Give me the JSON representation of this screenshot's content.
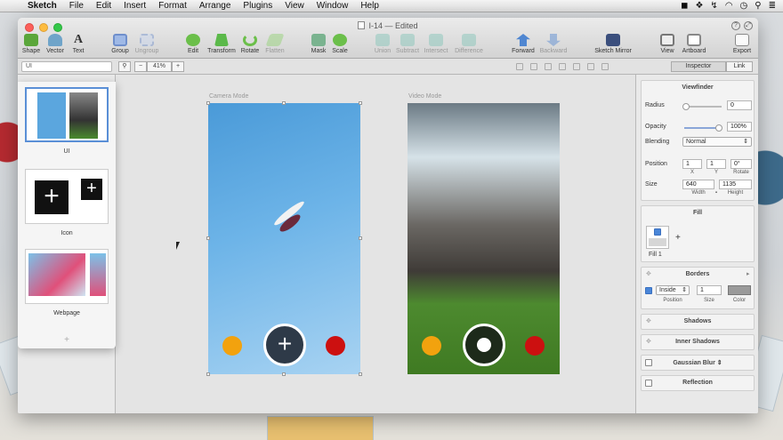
{
  "menubar": {
    "app": "Sketch",
    "items": [
      "File",
      "Edit",
      "Insert",
      "Format",
      "Arrange",
      "Plugins",
      "View",
      "Window",
      "Help"
    ]
  },
  "window": {
    "title": "I-14 — Edited"
  },
  "toolbar": {
    "left": [
      {
        "label": "Shape",
        "color": "#5aa63a"
      },
      {
        "label": "Vector",
        "color": "#6fa4c9"
      },
      {
        "label": "Text",
        "color": "#333333"
      }
    ],
    "group": {
      "label": "Group"
    },
    "ungroup": {
      "label": "Ungroup"
    },
    "edit_tools": [
      {
        "label": "Edit",
        "color": "#6bbf4a"
      },
      {
        "label": "Transform",
        "color": "#5bb94a"
      },
      {
        "label": "Rotate",
        "color": "#6bbf4a"
      },
      {
        "label": "Flatten",
        "color": "#8fd06f"
      }
    ],
    "mask": {
      "label": "Mask"
    },
    "scale": {
      "label": "Scale"
    },
    "boolean": [
      "Union",
      "Subtract",
      "Intersect",
      "Difference"
    ],
    "forward": {
      "label": "Forward"
    },
    "backward": {
      "label": "Backward"
    },
    "mirror": {
      "label": "Sketch Mirror"
    },
    "view": {
      "label": "View"
    },
    "artboard": {
      "label": "Artboard"
    },
    "export": {
      "label": "Export"
    }
  },
  "subbar": {
    "filter_value": "UI",
    "zoom_minus": "−",
    "zoom_level": "41%",
    "zoom_plus": "+",
    "tabs": [
      "Inspector",
      "Link"
    ]
  },
  "pages": [
    {
      "label": "UI",
      "selected": true
    },
    {
      "label": "Icon",
      "selected": false
    },
    {
      "label": "Webpage",
      "selected": false
    }
  ],
  "add_page": "+",
  "artboards": [
    {
      "label": "Camera Mode"
    },
    {
      "label": "Video Mode"
    }
  ],
  "camera_ui": {
    "left_dot": "#f2a20e",
    "right_dot": "#cc1010",
    "shutter_glyph": "+"
  },
  "inspector": {
    "title": "Viewfinder",
    "radius_label": "Radius",
    "radius_value": "0",
    "opacity_label": "Opacity",
    "opacity_value": "100%",
    "blending_label": "Blending",
    "blending_value": "Normal",
    "position_label": "Position",
    "pos_x": "1",
    "pos_y": "1",
    "rotate": "0°",
    "pos_x_label": "X",
    "pos_y_label": "Y",
    "rotate_label": "Rotate",
    "size_label": "Size",
    "width": "640",
    "height": "1135",
    "width_label": "Width",
    "height_label": "Height",
    "fill_title": "Fill",
    "fill_item_label": "Fill 1",
    "fill_add": "+",
    "borders_title": "Borders",
    "border_position": "Inside",
    "border_size": "1",
    "border_position_label": "Position",
    "border_size_label": "Size",
    "border_color_label": "Color",
    "shadows_title": "Shadows",
    "inner_shadows_title": "Inner Shadows",
    "gaussian_blur_title": "Gaussian Blur",
    "reflection_title": "Reflection"
  }
}
